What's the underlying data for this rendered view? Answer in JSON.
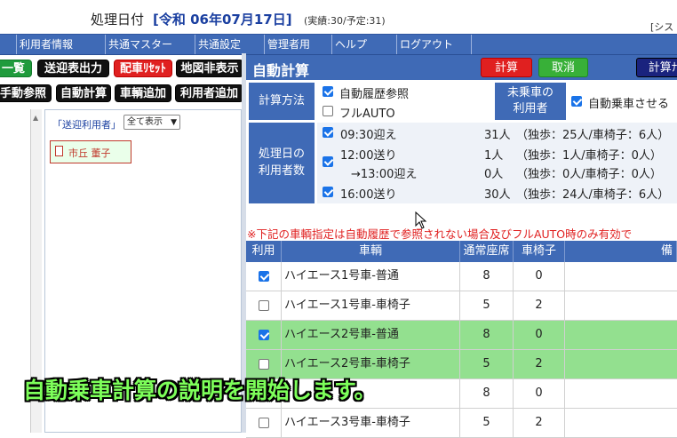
{
  "header": {
    "label": "処理日付",
    "date": "[令和 06年07月17日]",
    "note": "(実績:30/予定:31)",
    "system": "[シス"
  },
  "menu": [
    "利用者情報",
    "共通マスター",
    "共通設定",
    "管理者用",
    "ヘルプ",
    "ログアウト"
  ],
  "toolbar": {
    "row1": [
      "一覧",
      "送迎表出力",
      "配車ﾘｾｯﾄ",
      "地図非表示"
    ],
    "row2": [
      "手動参照",
      "自動計算",
      "車輌追加",
      "利用者追加"
    ]
  },
  "members": {
    "heading": "「送迎利用者」",
    "filter": "全て表示",
    "item": "市丘 董子"
  },
  "calc": {
    "title": "自動計算",
    "btn_calc": "計算",
    "btn_cancel": "取消",
    "btn_calc2": "計算ﾅ",
    "method_label": "計算方法",
    "opt_history": "自動履歴参照",
    "opt_full": "フルAUTO",
    "unassigned_label1": "未乗車の",
    "unassigned_label2": "利用者",
    "opt_auto_board": "自動乗車させる",
    "count_label1": "処理日の",
    "count_label2": "利用者数",
    "slots": [
      {
        "time": "09:30迎え",
        "count": "31人",
        "detail": "（独歩：25人/車椅子：6人）"
      },
      {
        "time": "12:00送り",
        "count": "1人",
        "detail": "（独歩：1人/車椅子：0人）"
      },
      {
        "time": "→13:00迎え",
        "count": "0人",
        "detail": "（独歩：0人/車椅子：0人）"
      },
      {
        "time": "16:00送り",
        "count": "30人",
        "detail": "（独歩：24人/車椅子：6人）"
      }
    ],
    "notice": "※下記の車輌指定は自動履歴で参照されない場合及びフルAUTO時のみ有効で"
  },
  "table": {
    "headers": [
      "利用",
      "車輌",
      "通常座席",
      "車椅子",
      "備"
    ],
    "rows": [
      {
        "name": "ハイエース1号車-普通",
        "seats": "8",
        "wheel": "0"
      },
      {
        "name": "ハイエース1号車-車椅子",
        "seats": "5",
        "wheel": "2"
      },
      {
        "name": "ハイエース2号車-普通",
        "seats": "8",
        "wheel": "0"
      },
      {
        "name": "ハイエース2号車-車椅子",
        "seats": "5",
        "wheel": "2"
      },
      {
        "name": "",
        "seats": "8",
        "wheel": "0"
      },
      {
        "name": "ハイエース3号車-車椅子",
        "seats": "5",
        "wheel": "2"
      }
    ]
  },
  "caption": "自動乗車計算の説明を開始します。"
}
